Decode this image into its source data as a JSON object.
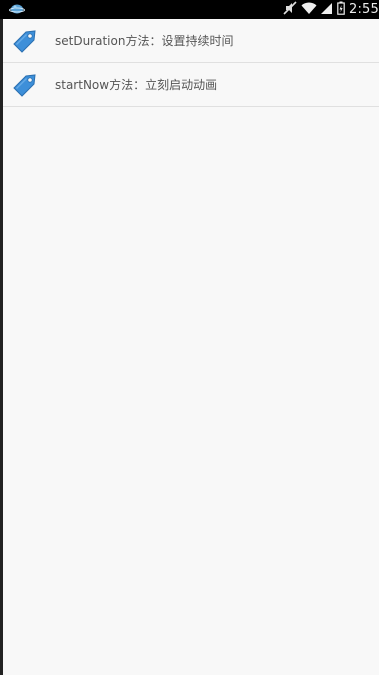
{
  "status_bar": {
    "time": "2:55",
    "icons": [
      "app-icon",
      "mute-icon",
      "wifi-icon",
      "signal-icon",
      "battery-icon"
    ]
  },
  "list": {
    "items": [
      {
        "label": "setDuration方法：设置持续时间",
        "icon": "tag-icon"
      },
      {
        "label": "startNow方法：立刻启动动画",
        "icon": "tag-icon"
      }
    ]
  },
  "colors": {
    "status_bar_bg": "#000000",
    "background": "#f8f8f8",
    "tag_blue": "#3d8fd9",
    "divider": "#e0e0e0",
    "text": "#555555"
  }
}
